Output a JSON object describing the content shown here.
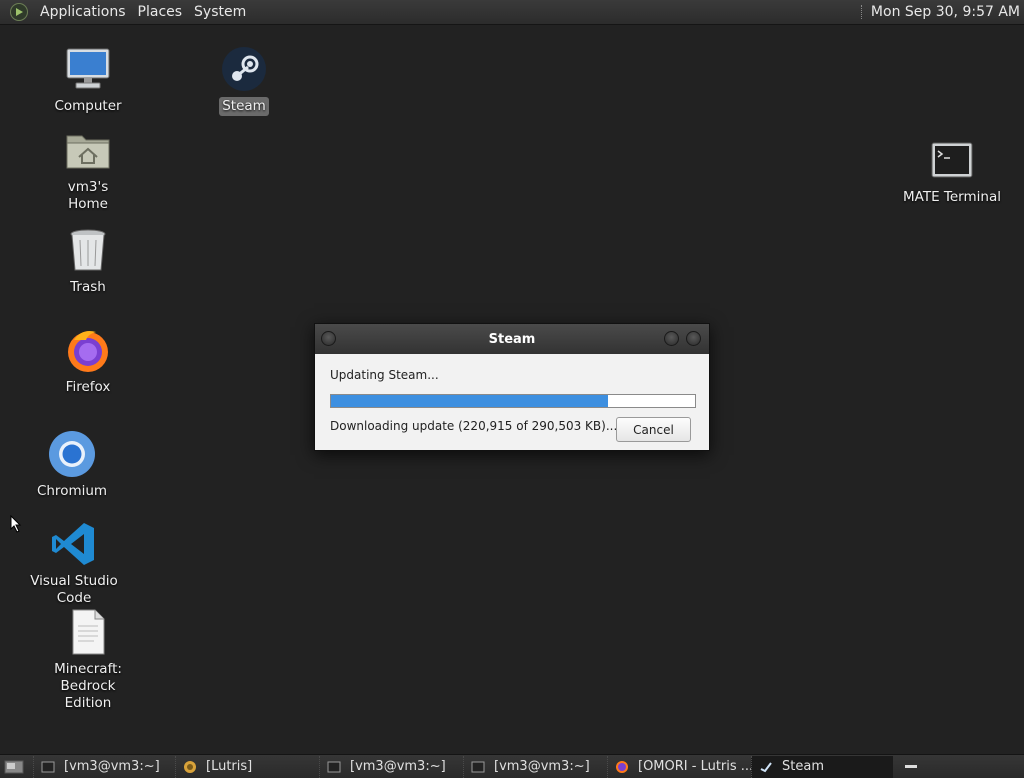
{
  "top_panel": {
    "menus": [
      "Applications",
      "Places",
      "System"
    ],
    "clock": "Mon Sep 30,  9:57 AM"
  },
  "desktop": {
    "icons": [
      {
        "label": "Computer",
        "icon": "computer-icon"
      },
      {
        "label": "Steam",
        "icon": "steam-icon",
        "selected": true
      },
      {
        "label": "vm3's Home",
        "icon": "home-folder-icon"
      },
      {
        "label": "Trash",
        "icon": "trash-icon"
      },
      {
        "label": "Firefox",
        "icon": "firefox-icon"
      },
      {
        "label": "Chromium",
        "icon": "chromium-icon"
      },
      {
        "label": "Visual Studio Code",
        "icon": "vscode-icon"
      },
      {
        "label": "Minecraft: Bedrock\nEdition",
        "icon": "document-icon"
      },
      {
        "label": "MATE Terminal",
        "icon": "terminal-icon"
      }
    ]
  },
  "dialog": {
    "title": "Steam",
    "status": "Updating Steam...",
    "progress_fraction": 0.76,
    "detail": "Downloading update (220,915 of 290,503 KB)...",
    "cancel_label": "Cancel"
  },
  "taskbar": {
    "tasks": [
      {
        "label": "[vm3@vm3:~]",
        "icon": "terminal-icon"
      },
      {
        "label": "[Lutris]",
        "icon": "lutris-icon"
      },
      {
        "label": "[vm3@vm3:~]",
        "icon": "terminal-icon"
      },
      {
        "label": "[vm3@vm3:~]",
        "icon": "terminal-icon"
      },
      {
        "label": "[OMORI - Lutris ...",
        "icon": "firefox-icon"
      },
      {
        "label": "Steam",
        "icon": "steam-icon",
        "active": true
      }
    ]
  },
  "colors": {
    "desktop_bg": "#222222",
    "progress_fill": "#3d8fe0",
    "panel": "#2f2f2f"
  }
}
